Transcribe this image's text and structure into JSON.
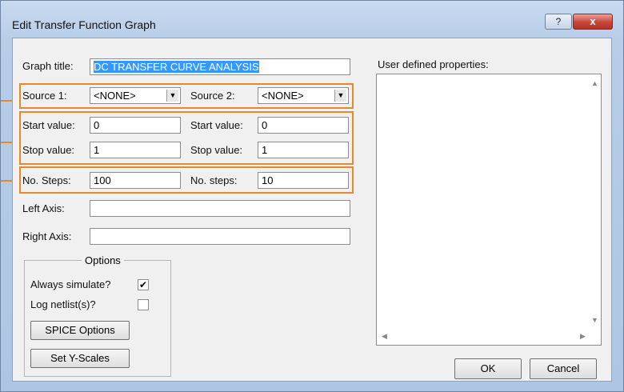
{
  "window": {
    "title": "Edit Transfer Function Graph",
    "help_label": "?",
    "close_label": "x"
  },
  "graph_title": {
    "label": "Graph title:",
    "value": "DC TRANSFER CURVE ANALYSIS"
  },
  "source1": {
    "label": "Source 1:",
    "value": "<NONE>"
  },
  "source2": {
    "label": "Source 2:",
    "value": "<NONE>"
  },
  "start1": {
    "label": "Start value:",
    "value": "0"
  },
  "start2": {
    "label": "Start value:",
    "value": "0"
  },
  "stop1": {
    "label": "Stop value:",
    "value": "1"
  },
  "stop2": {
    "label": "Stop value:",
    "value": "1"
  },
  "steps1": {
    "label": "No. Steps:",
    "value": "100"
  },
  "steps2": {
    "label": "No. steps:",
    "value": "10"
  },
  "left_axis": {
    "label": "Left Axis:",
    "value": ""
  },
  "right_axis": {
    "label": "Right Axis:",
    "value": ""
  },
  "options": {
    "title": "Options",
    "always_simulate": {
      "label": "Always simulate?",
      "checked": true,
      "mark": "✔"
    },
    "log_netlist": {
      "label": "Log netlist(s)?",
      "checked": false,
      "mark": ""
    },
    "spice_button": "SPICE Options",
    "yscales_button": "Set Y-Scales"
  },
  "user_props": {
    "label": "User defined properties:",
    "value": ""
  },
  "buttons": {
    "ok": "OK",
    "cancel": "Cancel"
  },
  "colors": {
    "highlight": "#e5892b",
    "selection": "#3399ff"
  }
}
